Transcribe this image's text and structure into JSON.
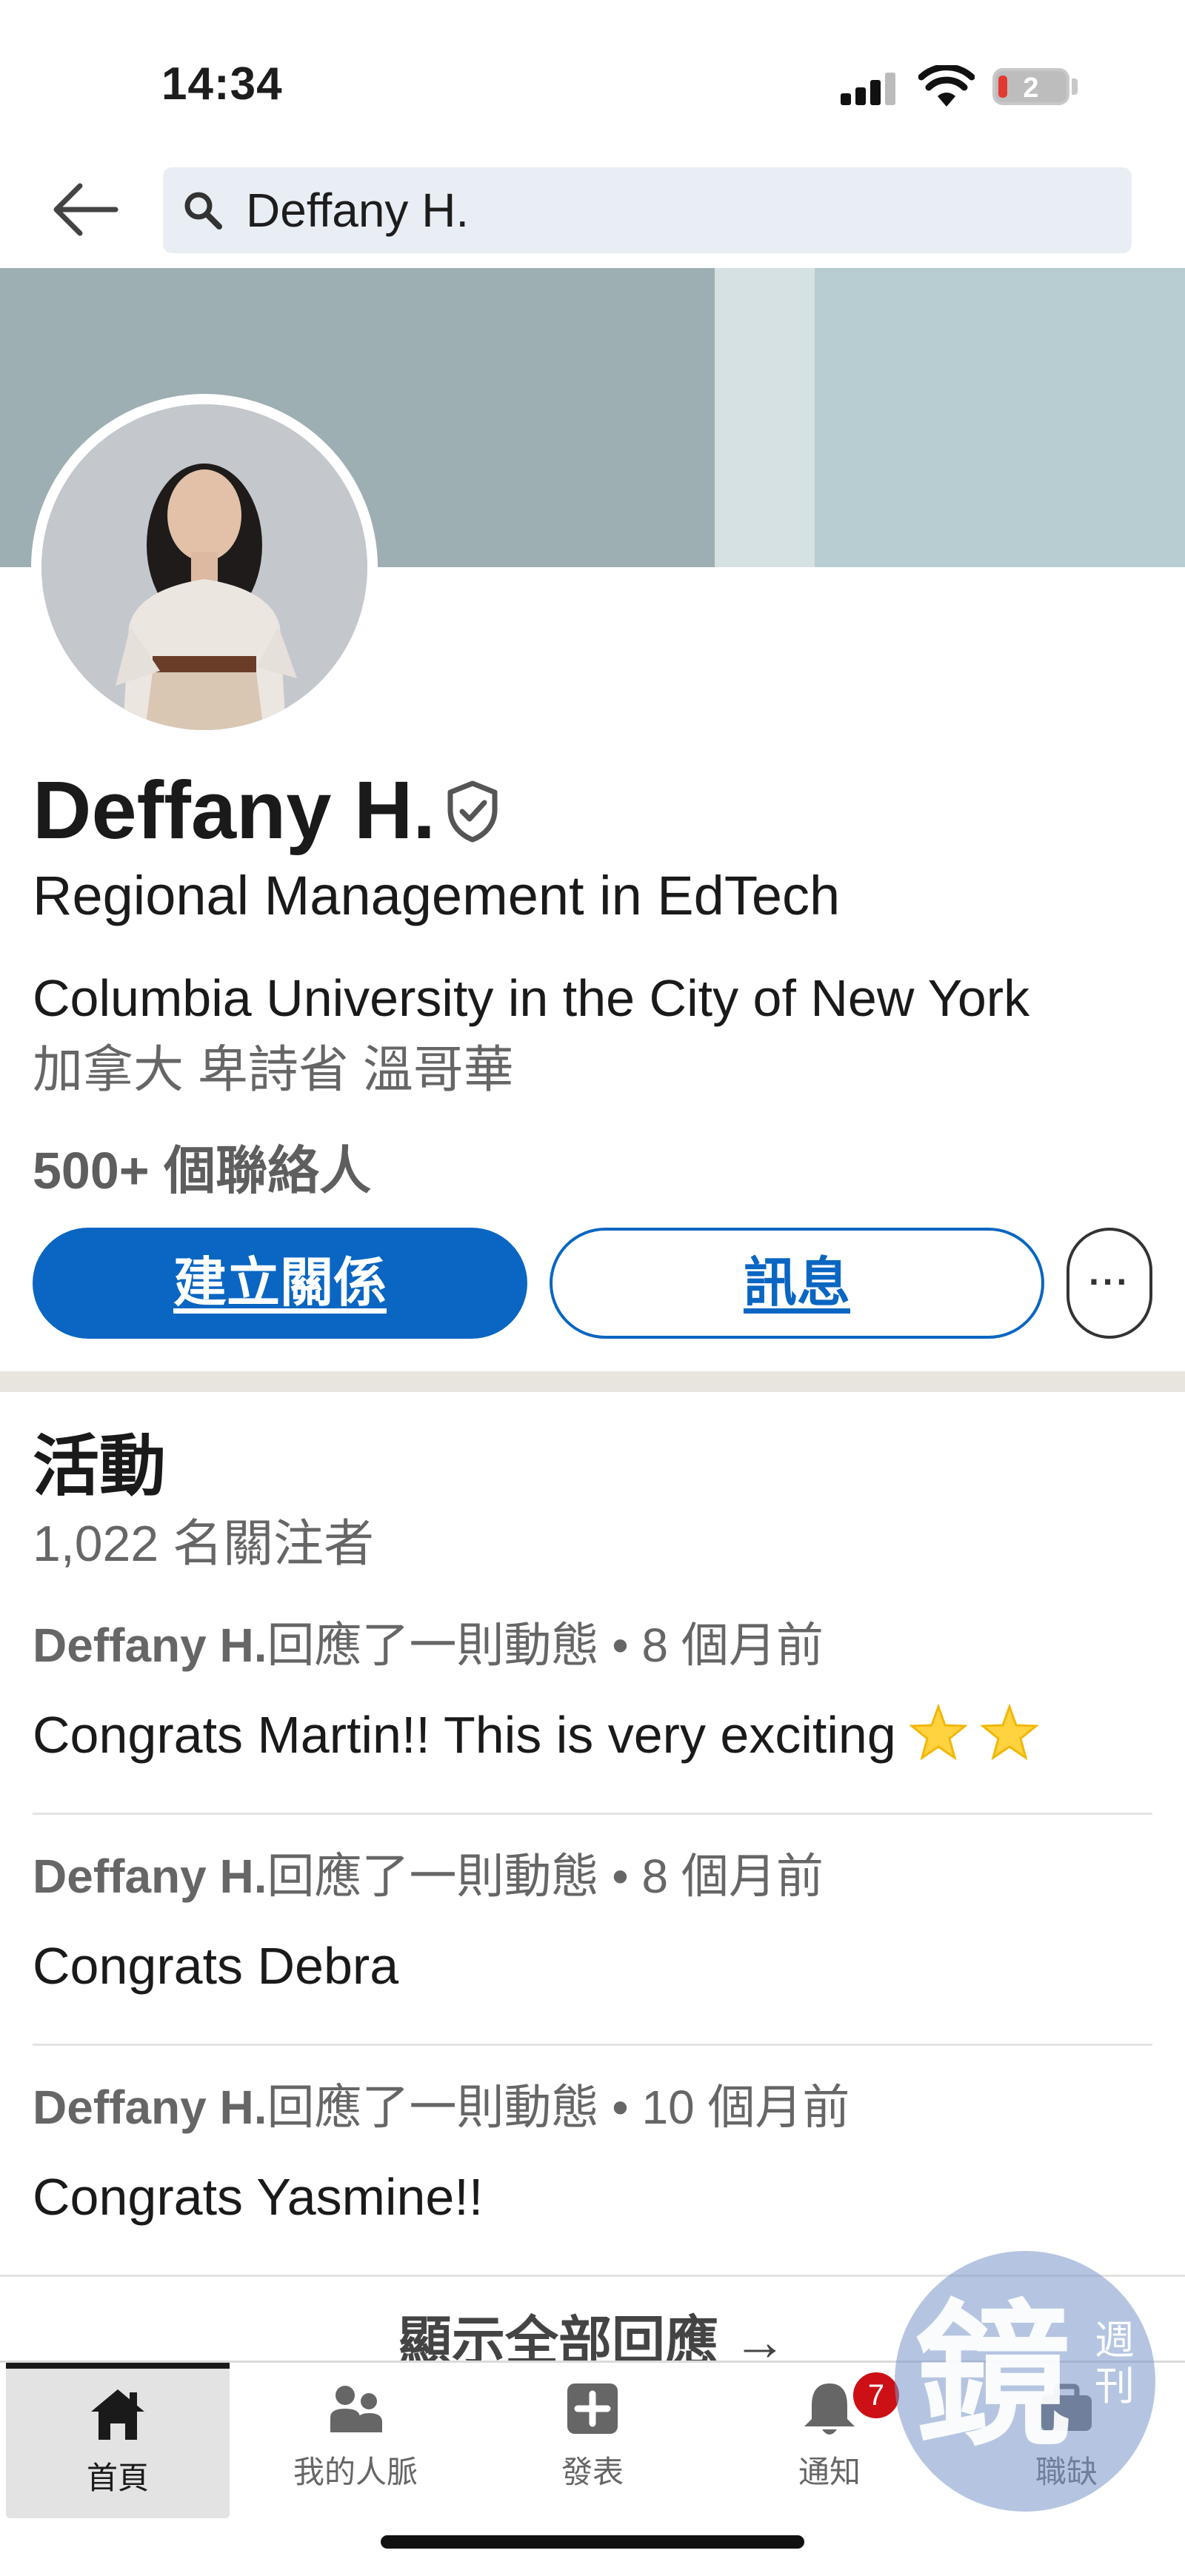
{
  "status_bar": {
    "time": "14:34",
    "battery": "2"
  },
  "search": {
    "query": "Deffany H."
  },
  "profile": {
    "name": "Deffany H.",
    "headline": "Regional Management in EdTech",
    "education": "Columbia University in the City of New York",
    "location": "加拿大 卑詩省 溫哥華",
    "connections": "500+ 個聯絡人"
  },
  "actions": {
    "connect": "建立關係",
    "message": "訊息",
    "more": "···"
  },
  "activity": {
    "title": "活動",
    "followers": "1,022 名關注者",
    "posts": [
      {
        "author": "Deffany H.",
        "action": "回應了一則動態",
        "time": "• 8 個月前",
        "text": "Congrats Martin!! This is very exciting",
        "emoji": "star"
      },
      {
        "author": "Deffany H.",
        "action": "回應了一則動態",
        "time": "• 8 個月前",
        "text": "Congrats Debra"
      },
      {
        "author": "Deffany H.",
        "action": "回應了一則動態",
        "time": "• 10 個月前",
        "text": "Congrats Yasmine!!"
      }
    ],
    "show_all": "顯示全部回應 →"
  },
  "nav": {
    "items": [
      {
        "label": "首頁",
        "icon": "home-icon",
        "active": true
      },
      {
        "label": "我的人脈",
        "icon": "people-icon"
      },
      {
        "label": "發表",
        "icon": "plus-square-icon"
      },
      {
        "label": "通知",
        "icon": "bell-icon",
        "badge": "7"
      },
      {
        "label": "職缺",
        "icon": "briefcase-icon"
      }
    ]
  },
  "watermark": {
    "main": "鏡",
    "side": "週刊"
  },
  "colors": {
    "accent": "#0a66c2",
    "badge": "#cc1016",
    "cover": "#9dafb3"
  }
}
